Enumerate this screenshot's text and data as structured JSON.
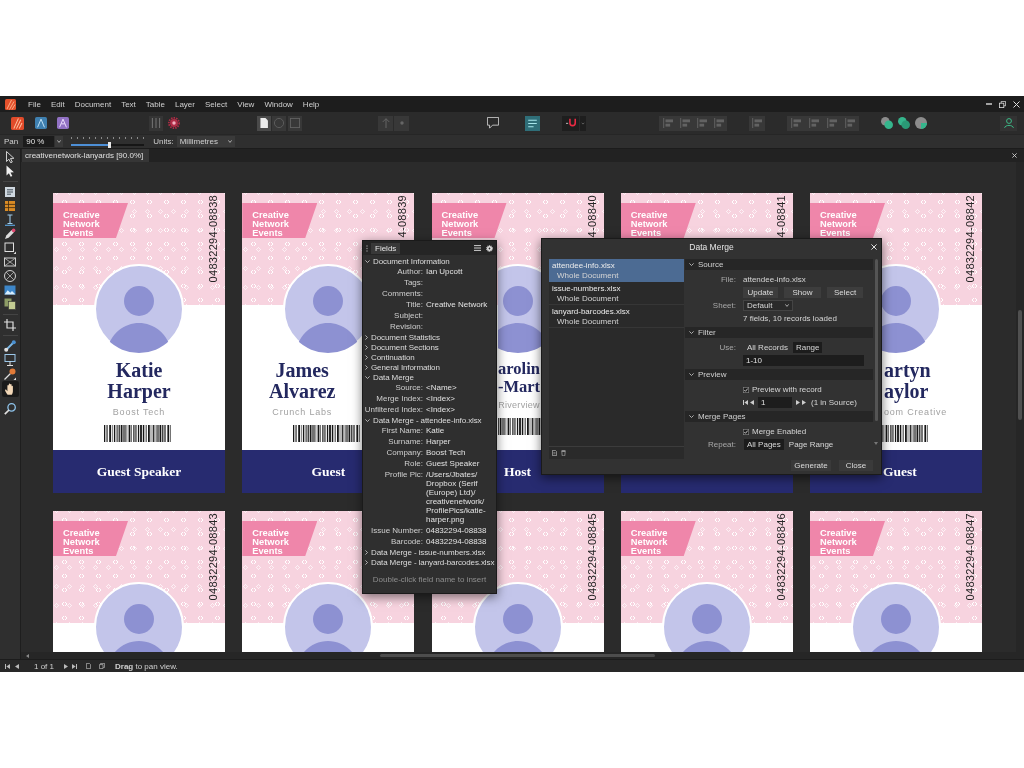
{
  "menu_bar": {
    "items": [
      "File",
      "Edit",
      "Document",
      "Text",
      "Table",
      "Layer",
      "Select",
      "View",
      "Window",
      "Help"
    ]
  },
  "context_bar": {
    "tool_label": "Pan",
    "zoom_field": {
      "value": "90 %"
    },
    "zoom_slider": {
      "level": 0.52
    },
    "units_label": "Units:",
    "units_dropdown": {
      "value": "Millimetres"
    }
  },
  "tools": [
    {
      "kind": "move",
      "selected": false
    },
    {
      "kind": "node",
      "selected": false
    },
    {
      "kind": "frame",
      "selected": false
    },
    {
      "kind": "table",
      "selected": false
    },
    {
      "kind": "text",
      "selected": false
    },
    {
      "kind": "pen",
      "selected": false
    },
    {
      "kind": "rectangle",
      "selected": false
    },
    {
      "kind": "pictureframe",
      "selected": false
    },
    {
      "kind": "ellipseframe",
      "selected": false
    },
    {
      "kind": "image",
      "selected": false
    },
    {
      "kind": "place",
      "selected": false
    },
    {
      "kind": "crop",
      "selected": false
    },
    {
      "kind": "fill",
      "selected": false
    },
    {
      "kind": "transparency",
      "selected": false
    },
    {
      "kind": "picker",
      "selected": false
    },
    {
      "kind": "hand",
      "selected": true
    },
    {
      "kind": "zoom",
      "selected": false
    }
  ],
  "document_tab": {
    "title": "creativenetwork-lanyards [90.0%]"
  },
  "cards": [
    {
      "brand": "Creative Network Events",
      "issue_number": "04832294-08838",
      "name": "Katie Harper",
      "company": "Boost Tech",
      "role": "Guest Speaker"
    },
    {
      "brand": "Creative Network Events",
      "issue_number": "4-08839",
      "name": "James Alvarez",
      "company": "Crunch Labs",
      "role": "Guest"
    },
    {
      "brand": "Creative Network Events",
      "issue_number": "4-08840",
      "name": "arolin -Mart",
      "company": "Riverview",
      "role": "Host"
    },
    {
      "brand": "Creative Network Events",
      "issue_number": "4-08841"
    },
    {
      "brand": "Creative Network Events",
      "issue_number": "04832294-08842",
      "name": "artyn aylor",
      "company": "oom Creative",
      "role": "Guest"
    },
    {
      "brand": "Creative Network Events",
      "issue_number": "04832294-08843"
    },
    {
      "brand": "Creative Network Events"
    },
    {
      "issue_number": "04832294-08845"
    },
    {
      "brand": "Creative Network Events",
      "issue_number": "04832294-08846"
    },
    {
      "brand": "Creative Network Events",
      "issue_number": "04832294-08847"
    }
  ],
  "fields_panel": {
    "tab": "Fields",
    "sections": [
      {
        "title": "Document Information",
        "expanded": true,
        "rows": [
          {
            "label": "Author:",
            "value": "Ian Upcott"
          },
          {
            "label": "Tags:"
          },
          {
            "label": "Comments:"
          },
          {
            "label": "Title:",
            "value": "Creative Network"
          },
          {
            "label": "Subject:"
          },
          {
            "label": "Revision:"
          }
        ]
      },
      {
        "title": "Document Statistics",
        "expanded": false
      },
      {
        "title": "Document Sections",
        "expanded": false
      },
      {
        "title": "Continuation",
        "expanded": false
      },
      {
        "title": "General Information",
        "expanded": false
      },
      {
        "title": "Data Merge",
        "expanded": true,
        "rows": [
          {
            "label": "Source:",
            "value": "<Name>"
          },
          {
            "label": "Merge Index:",
            "value": "<Index>"
          },
          {
            "label": "Unfiltered Index:",
            "value": "<Index>"
          }
        ]
      },
      {
        "title": "Data Merge - attendee-info.xlsx",
        "expanded": true,
        "rows": [
          {
            "label": "First Name:",
            "value": "Katie"
          },
          {
            "label": "Surname:",
            "value": "Harper"
          },
          {
            "label": "Company:",
            "value": "Boost Tech"
          },
          {
            "label": "Role:",
            "value": "Guest Speaker"
          },
          {
            "label": "Profile Pic:",
            "value": "/Users/Jbates/Dropbox (Serif (Europe) Ltd)/creativenetwork/ProfilePics/katie-harper.png"
          },
          {
            "label": "Issue Number:",
            "value": "04832294-08838"
          },
          {
            "label": "Barcode:",
            "value": "04832294-08838"
          }
        ]
      },
      {
        "title": "Data Merge - issue-numbers.xlsx",
        "expanded": false
      },
      {
        "title": "Data Merge - lanyard-barcodes.xlsx",
        "expanded": false
      }
    ],
    "hint": "Double-click field name to insert"
  },
  "data_merge_dialog": {
    "title": "Data Merge",
    "sources": [
      {
        "file": "attendee-info.xlsx",
        "scope": "Whole Document",
        "selected": true
      },
      {
        "file": "issue-numbers.xlsx",
        "scope": "Whole Document",
        "selected": false
      },
      {
        "file": "lanyard-barcodes.xlsx",
        "scope": "Whole Document",
        "selected": false
      }
    ],
    "source": {
      "title": "Source",
      "expanded": true,
      "file_label": "File:",
      "file": "attendee-info.xlsx",
      "buttons": [
        "Update",
        "Show",
        "Select"
      ],
      "sheet_label": "Sheet:",
      "sheet": {
        "value": "Default"
      },
      "summary": "7 fields, 10 records loaded"
    },
    "filter": {
      "title": "Filter",
      "expanded": true,
      "use_label": "Use:",
      "options": [
        {
          "label": "All Records",
          "selected": false
        },
        {
          "label": "Range",
          "selected": true
        }
      ],
      "range_field": {
        "value": "1-10"
      }
    },
    "preview": {
      "title": "Preview",
      "expanded": true,
      "checkbox": {
        "label": "Preview with record",
        "checked": true
      },
      "record_field": {
        "value": "1"
      },
      "record_info": "(1 in Source)"
    },
    "merge_pages": {
      "title": "Merge Pages",
      "expanded": true,
      "checkbox": {
        "label": "Merge Enabled",
        "checked": true
      },
      "repeat_label": "Repeat:",
      "options": [
        {
          "label": "All Pages",
          "selected": true
        },
        {
          "label": "Page Range",
          "selected": false
        }
      ]
    },
    "buttons": [
      "Generate",
      "Close"
    ]
  },
  "status_bar": {
    "page_info": "1 of 1",
    "hint": "**Drag** to pan view."
  }
}
